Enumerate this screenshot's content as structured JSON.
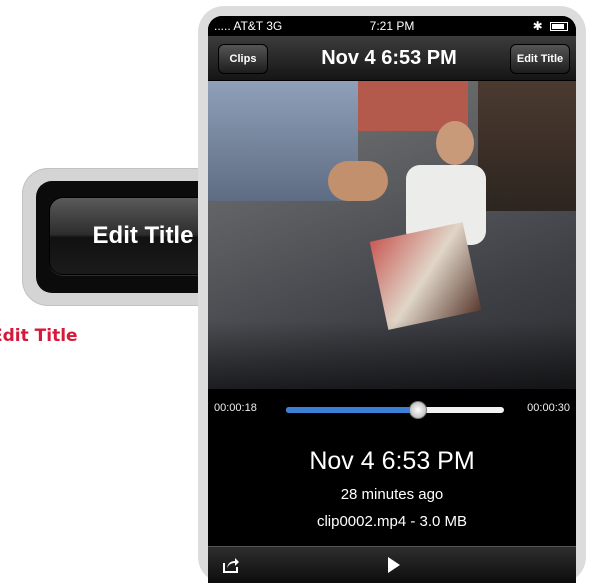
{
  "callout": {
    "button_label": "Edit Title",
    "caption": "Edit Title",
    "caption_color": "#d6183a"
  },
  "status_bar": {
    "carrier": "..... AT&T 3G",
    "time": "7:21 PM",
    "icons": [
      "bluetooth-icon",
      "battery-icon"
    ]
  },
  "nav": {
    "back_label": "Clips",
    "title": "Nov 4  6:53 PM",
    "edit_label": "Edit Title"
  },
  "player": {
    "elapsed": "00:00:18",
    "total": "00:00:30",
    "progress_fraction": 0.6,
    "track_color": "#3b7fd6"
  },
  "clip_info": {
    "title": "Nov 4  6:53 PM",
    "age": "28 minutes ago",
    "file": "clip0002.mp4  -  3.0 MB"
  },
  "toolbar": {
    "icons": [
      "share-icon",
      "play-icon"
    ]
  }
}
